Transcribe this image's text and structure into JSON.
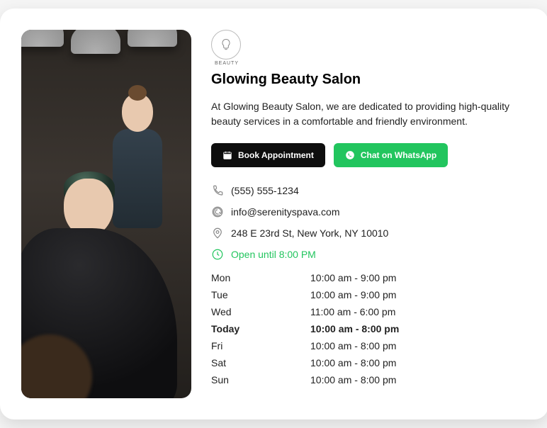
{
  "logo_label": "BEAUTY",
  "title": "Glowing Beauty Salon",
  "description": "At Glowing Beauty Salon, we are dedicated to providing high-quality beauty services in a comfortable and friendly environment.",
  "buttons": {
    "book": "Book Appointment",
    "whatsapp": "Chat on WhatsApp"
  },
  "contact": {
    "phone": "(555) 555-1234",
    "email": "info@serenityspava.com",
    "address": "248 E 23rd St, New York, NY 10010",
    "open_status": "Open until 8:00 PM"
  },
  "hours": [
    {
      "day": "Mon",
      "time": "10:00 am - 9:00 pm",
      "bold": false
    },
    {
      "day": "Tue",
      "time": "10:00 am - 9:00 pm",
      "bold": false
    },
    {
      "day": "Wed",
      "time": "11:00 am - 6:00 pm",
      "bold": false
    },
    {
      "day": "Today",
      "time": "10:00 am - 8:00 pm",
      "bold": true
    },
    {
      "day": "Fri",
      "time": "10:00 am - 8:00 pm",
      "bold": false
    },
    {
      "day": "Sat",
      "time": "10:00 am - 8:00 pm",
      "bold": false
    },
    {
      "day": "Sun",
      "time": "10:00 am - 8:00 pm",
      "bold": false
    }
  ]
}
